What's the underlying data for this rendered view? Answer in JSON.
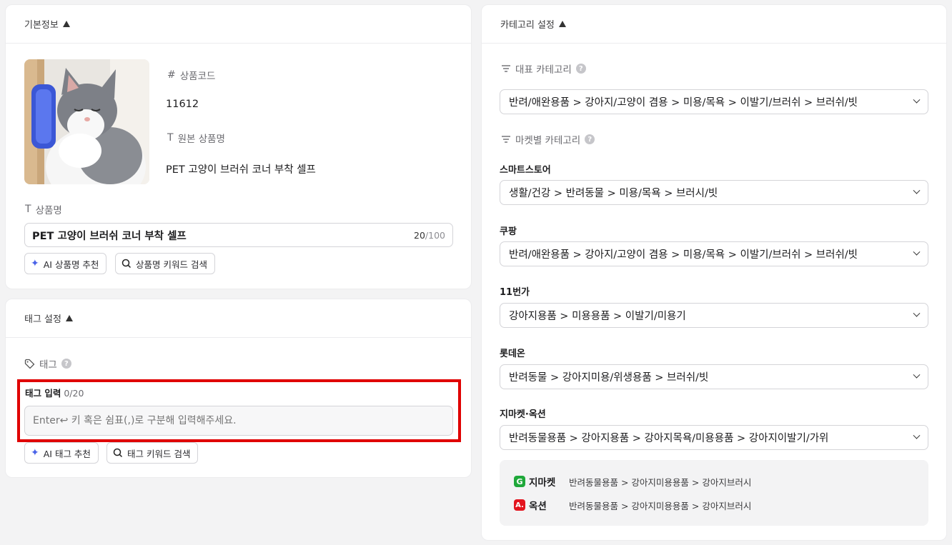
{
  "basic": {
    "header": "기본정보",
    "product_code_label": "상품코드",
    "product_code": "11612",
    "original_name_label": "원본 상품명",
    "original_name": "PET 고양이 브러쉬 코너 부착 셀프",
    "name_label": "상품명",
    "name_value": "PET 고양이 브러쉬 코너 부착 셀프",
    "name_count": "20",
    "name_max": "/100",
    "ai_name_button": "AI 상품명 추천",
    "keyword_name_button": "상품명 키워드 검색"
  },
  "tags": {
    "header": "태그 설정",
    "tag_label": "태그",
    "input_label": "태그 입력",
    "input_count": "0/20",
    "placeholder": "Enter↩ 키 혹은 쉼표(,)로 구분해 입력해주세요.",
    "ai_tag_button": "AI 태그 추천",
    "keyword_tag_button": "태그 키워드 검색"
  },
  "category": {
    "header": "카테고리 설정",
    "main_label": "대표 카테고리",
    "main_value": "반려/애완용품 > 강아지/고양이 겸용 > 미용/목욕 > 이발기/브러쉬 > 브러쉬/빗",
    "market_label": "마켓별 카테고리",
    "markets": [
      {
        "name": "스마트스토어",
        "value": "생활/건강 > 반려동물 > 미용/목욕 > 브러시/빗"
      },
      {
        "name": "쿠팡",
        "value": "반려/애완용품 > 강아지/고양이 겸용 > 미용/목욕 > 이발기/브러쉬 > 브러쉬/빗"
      },
      {
        "name": "11번가",
        "value": "강아지용품 > 미용용품 > 이발기/미용기"
      },
      {
        "name": "롯데온",
        "value": "반려동물 > 강아지미용/위생용품 > 브러쉬/빗"
      },
      {
        "name": "지마켓·옥션",
        "value": "반려동물용품 > 강아지용품 > 강아지목욕/미용용품 > 강아지이발기/가위"
      }
    ],
    "sub": [
      {
        "brand": "지마켓",
        "letter": "G",
        "color": "#1fa83a",
        "path": "반려동물용품 > 강아지미용용품 > 강아지브러시"
      },
      {
        "brand": "옥션",
        "letter": "A.",
        "color": "#e3141e",
        "path": "반려동물용품 > 강아지미용용품 > 강아지브러시"
      }
    ]
  },
  "colors": {
    "highlight": "#e00000",
    "ai_sparkle": "#4a63e8"
  }
}
